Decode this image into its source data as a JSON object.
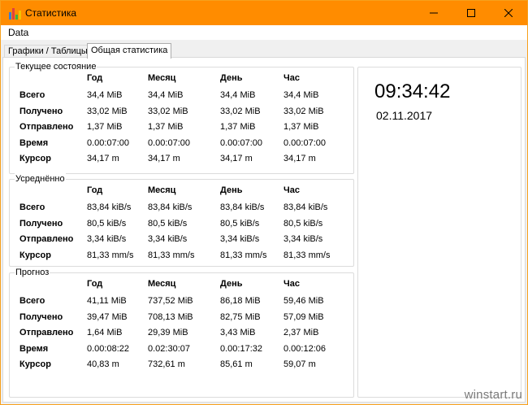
{
  "window": {
    "title": "Статистика",
    "accent_color": "#ff8c00",
    "icons": {
      "app": "bar-chart-icon",
      "minimize": "minimize-icon",
      "maximize": "maximize-icon",
      "close": "close-icon"
    }
  },
  "menu": {
    "items": [
      "Data"
    ]
  },
  "tabs": [
    {
      "label": "Графики / Таблицы",
      "active": false
    },
    {
      "label": "Общая статистика",
      "active": true
    }
  ],
  "columns": [
    "Год",
    "Месяц",
    "День",
    "Час"
  ],
  "groups": [
    {
      "title": "Текущее состояние",
      "rows": [
        {
          "label": "Всего",
          "values": [
            "34,4 MiB",
            "34,4 MiB",
            "34,4 MiB",
            "34,4 MiB"
          ]
        },
        {
          "label": "Получено",
          "values": [
            "33,02 MiB",
            "33,02 MiB",
            "33,02 MiB",
            "33,02 MiB"
          ]
        },
        {
          "label": "Отправлено",
          "values": [
            "1,37 MiB",
            "1,37 MiB",
            "1,37 MiB",
            "1,37 MiB"
          ]
        },
        {
          "label": "Время",
          "values": [
            "0.00:07:00",
            "0.00:07:00",
            "0.00:07:00",
            "0.00:07:00"
          ]
        },
        {
          "label": "Курсор",
          "values": [
            "34,17 m",
            "34,17 m",
            "34,17 m",
            "34,17 m"
          ]
        }
      ]
    },
    {
      "title": "Усреднённо",
      "rows": [
        {
          "label": "Всего",
          "values": [
            "83,84 kiB/s",
            "83,84 kiB/s",
            "83,84 kiB/s",
            "83,84 kiB/s"
          ]
        },
        {
          "label": "Получено",
          "values": [
            "80,5 kiB/s",
            "80,5 kiB/s",
            "80,5 kiB/s",
            "80,5 kiB/s"
          ]
        },
        {
          "label": "Отправлено",
          "values": [
            "3,34 kiB/s",
            "3,34 kiB/s",
            "3,34 kiB/s",
            "3,34 kiB/s"
          ]
        },
        {
          "label": "Курсор",
          "values": [
            "81,33 mm/s",
            "81,33 mm/s",
            "81,33 mm/s",
            "81,33 mm/s"
          ]
        }
      ]
    },
    {
      "title": "Прогноз",
      "rows": [
        {
          "label": "Всего",
          "values": [
            "41,11 MiB",
            "737,52 MiB",
            "86,18 MiB",
            "59,46 MiB"
          ]
        },
        {
          "label": "Получено",
          "values": [
            "39,47 MiB",
            "708,13 MiB",
            "82,75 MiB",
            "57,09 MiB"
          ]
        },
        {
          "label": "Отправлено",
          "values": [
            "1,64 MiB",
            "29,39 MiB",
            "3,43 MiB",
            "2,37 MiB"
          ]
        },
        {
          "label": "Время",
          "values": [
            "0.00:08:22",
            "0.02:30:07",
            "0.00:17:32",
            "0.00:12:06"
          ]
        },
        {
          "label": "Курсор",
          "values": [
            "40,83 m",
            "732,61 m",
            "85,61 m",
            "59,07 m"
          ]
        }
      ]
    }
  ],
  "clock": {
    "time": "09:34:42",
    "date": "02.11.2017"
  },
  "watermark": "winstart.ru"
}
